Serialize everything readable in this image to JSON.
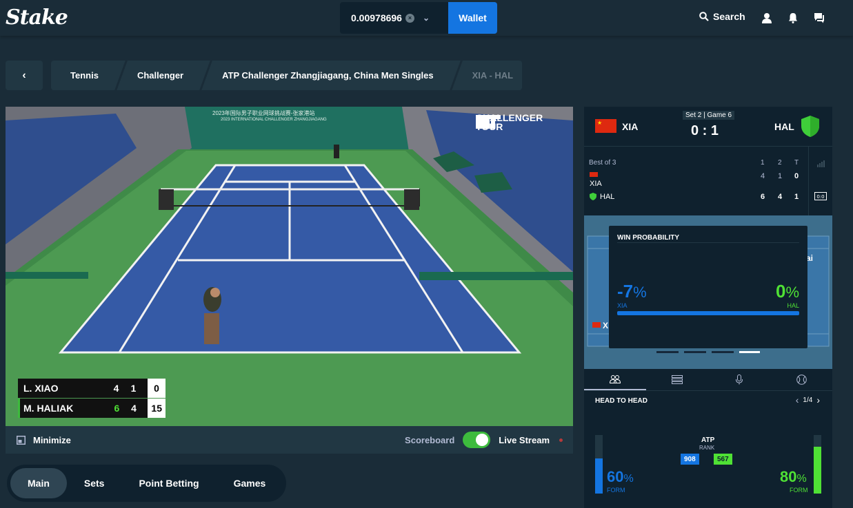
{
  "header": {
    "logo": "Stake",
    "balance": "0.00978696",
    "wallet_label": "Wallet",
    "search_label": "Search"
  },
  "breadcrumb": {
    "items": [
      "Tennis",
      "Challenger",
      "ATP Challenger Zhangjiagang, China Men Singles",
      "XIA - HAL"
    ]
  },
  "video": {
    "overlay": {
      "players": [
        {
          "name": "L. XIAO",
          "set1": "4",
          "set2": "1",
          "points": "0"
        },
        {
          "name": "M. HALIAK",
          "set1": "6",
          "set2": "4",
          "points": "15"
        }
      ]
    },
    "challenger_logo_line1": "CHALLENGER",
    "challenger_logo_line2": "TOUR",
    "banner_text": "2023年国际男子职业网球挑战赛-张家港站",
    "banner_subtext": "2023 INTERNATIONAL CHALLENGER ZHANGJIAGANG"
  },
  "video_controls": {
    "minimize_label": "Minimize",
    "scoreboard_label": "Scoreboard",
    "live_stream_label": "Live Stream",
    "live_stream_on": true
  },
  "market_tabs": {
    "items": [
      "Main",
      "Sets",
      "Point Betting",
      "Games"
    ],
    "active": "Main"
  },
  "scoreboard": {
    "home_code": "XIA",
    "away_code": "HAL",
    "set_game": "Set 2 | Game 6",
    "score": "0 : 1",
    "best_of": "Best of 3",
    "col_headers": [
      "1",
      "2",
      "T"
    ],
    "rows": [
      {
        "name": "XIA",
        "s1": "4",
        "s2": "1",
        "t": "0"
      },
      {
        "name": "HAL",
        "s1": "6",
        "s2": "4",
        "t": "1"
      }
    ]
  },
  "win_probability": {
    "title": "WIN PROBABILITY",
    "left_value": "-7",
    "right_value": "0",
    "pct": "%",
    "left_name": "XIA",
    "right_name": "HAL",
    "bg_label_right": "ai",
    "bg_label_left": "X"
  },
  "head_to_head": {
    "title": "HEAD TO HEAD",
    "page": "1/4",
    "atp_label": "ATP",
    "rank_label": "RANK",
    "home_rank": "908",
    "away_rank": "567",
    "home_form": "60",
    "away_form": "80",
    "home_form_fraction": 0.6,
    "away_form_fraction": 0.8,
    "form_label": "FORM",
    "pct": "%"
  },
  "colors": {
    "bg": "#1a2c38",
    "panel": "#213743",
    "dark": "#0f212e",
    "accent_blue": "#1475e1",
    "accent_green": "#4fe135"
  }
}
